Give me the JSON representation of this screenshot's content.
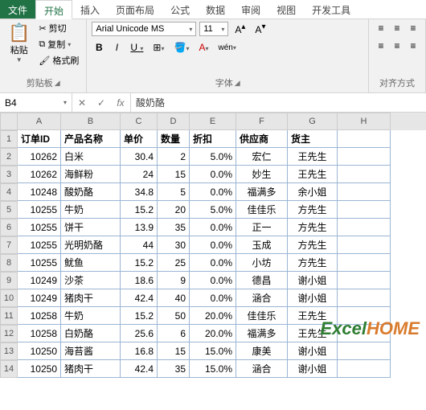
{
  "tabs": {
    "file": "文件",
    "home": "开始",
    "insert": "插入",
    "layout": "页面布局",
    "formula": "公式",
    "data": "数据",
    "review": "审阅",
    "view": "视图",
    "dev": "开发工具"
  },
  "ribbon": {
    "paste": "粘贴",
    "cut": "剪切",
    "copy": "复制",
    "format_painter": "格式刷",
    "group_clipboard": "剪贴板",
    "group_font": "字体",
    "group_align": "对齐方式",
    "font_name": "Arial Unicode MS",
    "font_size": "11",
    "bold": "B",
    "italic": "I",
    "underline": "U",
    "wen": "wén"
  },
  "formula_bar": {
    "cell_ref": "B4",
    "fx": "fx",
    "value": "酸奶酪"
  },
  "columns": [
    "A",
    "B",
    "C",
    "D",
    "E",
    "F",
    "G",
    "H"
  ],
  "col_widths": [
    "wA",
    "wB",
    "wC",
    "wD",
    "wE",
    "wF",
    "wG",
    "wH"
  ],
  "headers": [
    "订单ID",
    "产品名称",
    "单价",
    "数量",
    "折扣",
    "供应商",
    "货主"
  ],
  "rows": [
    {
      "n": 2,
      "c": [
        "10262",
        "白米",
        "30.4",
        "2",
        "5.0%",
        "宏仁",
        "王先生"
      ]
    },
    {
      "n": 3,
      "c": [
        "10262",
        "海鲜粉",
        "24",
        "15",
        "0.0%",
        "妙生",
        "王先生"
      ]
    },
    {
      "n": 4,
      "c": [
        "10248",
        "酸奶酪",
        "34.8",
        "5",
        "0.0%",
        "福满多",
        "余小姐"
      ]
    },
    {
      "n": 5,
      "c": [
        "10255",
        "牛奶",
        "15.2",
        "20",
        "5.0%",
        "佳佳乐",
        "方先生"
      ]
    },
    {
      "n": 6,
      "c": [
        "10255",
        "饼干",
        "13.9",
        "35",
        "0.0%",
        "正一",
        "方先生"
      ]
    },
    {
      "n": 7,
      "c": [
        "10255",
        "光明奶酪",
        "44",
        "30",
        "0.0%",
        "玉成",
        "方先生"
      ]
    },
    {
      "n": 8,
      "c": [
        "10255",
        "鱿鱼",
        "15.2",
        "25",
        "0.0%",
        "小坊",
        "方先生"
      ]
    },
    {
      "n": 9,
      "c": [
        "10249",
        "沙茶",
        "18.6",
        "9",
        "0.0%",
        "德昌",
        "谢小姐"
      ]
    },
    {
      "n": 10,
      "c": [
        "10249",
        "猪肉干",
        "42.4",
        "40",
        "0.0%",
        "涵合",
        "谢小姐"
      ]
    },
    {
      "n": 11,
      "c": [
        "10258",
        "牛奶",
        "15.2",
        "50",
        "20.0%",
        "佳佳乐",
        "王先生"
      ]
    },
    {
      "n": 12,
      "c": [
        "10258",
        "白奶酪",
        "25.6",
        "6",
        "20.0%",
        "福满多",
        "王先生"
      ]
    },
    {
      "n": 13,
      "c": [
        "10250",
        "海苔酱",
        "16.8",
        "15",
        "15.0%",
        "康美",
        "谢小姐"
      ]
    },
    {
      "n": 14,
      "c": [
        "10250",
        "猪肉干",
        "42.4",
        "35",
        "15.0%",
        "涵合",
        "谢小姐"
      ]
    }
  ],
  "align": [
    "num",
    "",
    "num",
    "num",
    "num",
    "ctr",
    "ctr"
  ],
  "watermark": {
    "a": "Excel",
    "b": "HOME"
  }
}
